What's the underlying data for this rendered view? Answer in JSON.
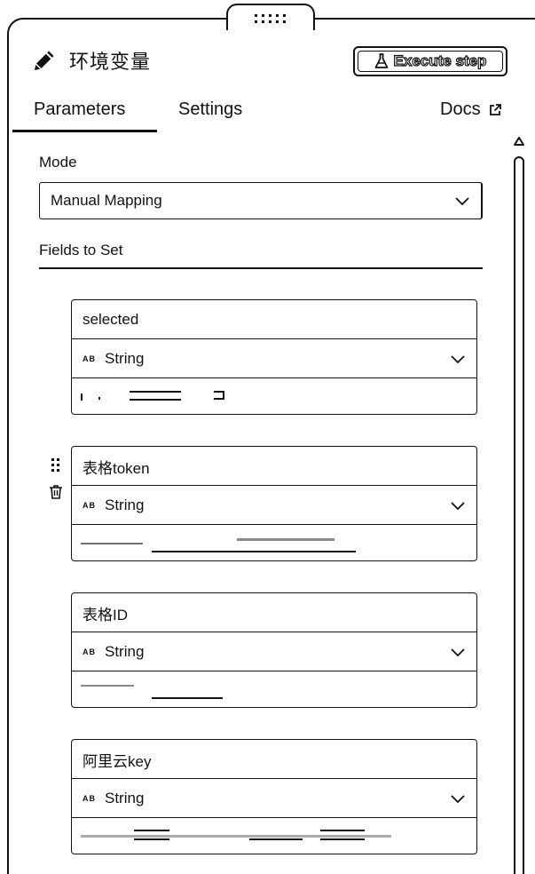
{
  "header": {
    "title": "环境变量",
    "execute_label": "Execute step"
  },
  "tabs": [
    {
      "label": "Parameters",
      "active": true
    },
    {
      "label": "Settings",
      "active": false
    },
    {
      "label": "Docs",
      "active": false
    }
  ],
  "form": {
    "mode_label": "Mode",
    "mode_value": "Manual Mapping",
    "fields_label": "Fields to Set",
    "fields": [
      {
        "name": "selected",
        "type": "String"
      },
      {
        "name": "表格token",
        "type": "String"
      },
      {
        "name": "表格ID",
        "type": "String"
      },
      {
        "name": "阿里云key",
        "type": "String"
      }
    ]
  },
  "icons": [
    "pencil-icon",
    "flask-icon",
    "external-link-icon",
    "chevron-down-icon",
    "drag-handle-icon",
    "trash-icon"
  ]
}
